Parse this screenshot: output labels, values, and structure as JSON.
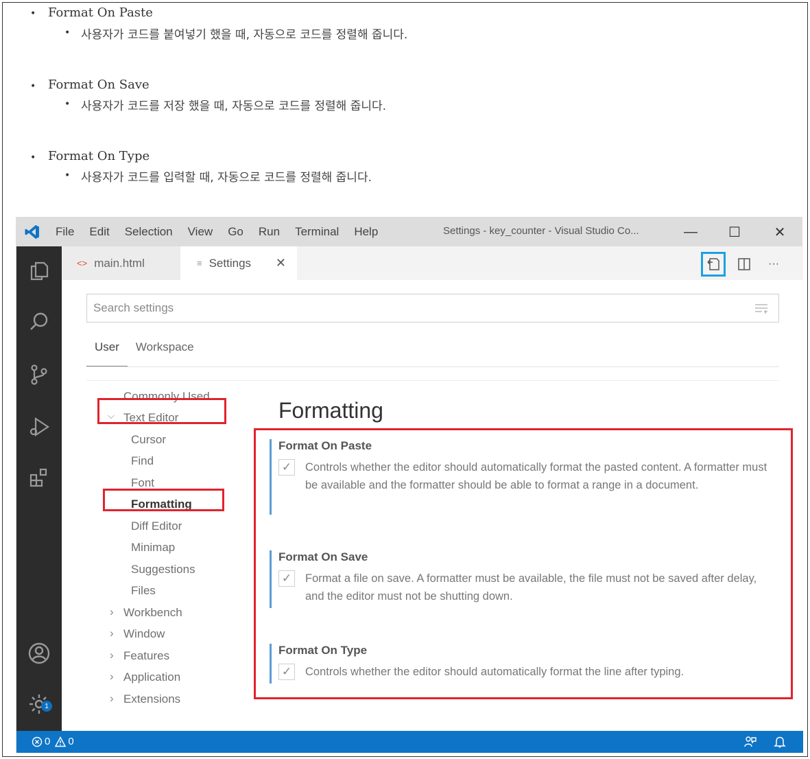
{
  "doc": {
    "items": [
      {
        "title": "Format On Paste",
        "desc": "사용자가 코드를 붙여넣기 했을 때, 자동으로 코드를 정렬해 줍니다."
      },
      {
        "title": "Format On Save",
        "desc": "사용자가 코드를 저장 했을 때, 자동으로 코드를 정렬해 줍니다."
      },
      {
        "title": "Format On Type",
        "desc": "사용자가 코드를 입력할 때, 자동으로 코드를 정렬해 줍니다."
      }
    ]
  },
  "titlebar": {
    "menu": [
      "File",
      "Edit",
      "Selection",
      "View",
      "Go",
      "Run",
      "Terminal",
      "Help"
    ],
    "window_title": "Settings - key_counter - Visual Studio Co...",
    "minimize": "—",
    "maximize": "☐",
    "close": "✕"
  },
  "tabs": [
    {
      "label": "main.html",
      "icon": "<>"
    },
    {
      "label": "Settings",
      "icon": "≡",
      "close": "✕"
    }
  ],
  "tab_actions": [
    "open-settings-json-icon",
    "split-editor-icon",
    "more-actions-icon"
  ],
  "more_label": "···",
  "search": {
    "placeholder": "Search settings"
  },
  "scope_tabs": [
    "User",
    "Workspace"
  ],
  "toc": {
    "commonly_used": "Commonly Used",
    "text_editor": "Text Editor",
    "text_editor_children": [
      "Cursor",
      "Find",
      "Font",
      "Formatting",
      "Diff Editor",
      "Minimap",
      "Suggestions",
      "Files"
    ],
    "collapsed": [
      "Workbench",
      "Window",
      "Features",
      "Application",
      "Extensions"
    ],
    "chevron_open": "⌵",
    "chevron_closed": "›"
  },
  "section_title": "Formatting",
  "settings": [
    {
      "name": "Format On Paste",
      "checked": true,
      "description": "Controls whether the editor should automatically format the pasted content. A formatter must be available and the formatter should be able to format a range in a document."
    },
    {
      "name": "Format On Save",
      "checked": true,
      "description": "Format a file on save. A formatter must be available, the file must not be saved after delay, and the editor must not be shutting down."
    },
    {
      "name": "Format On Type",
      "checked": true,
      "description": "Controls whether the editor should automatically format the line after typing."
    }
  ],
  "checkmark": "✓",
  "status": {
    "errors": "0",
    "warnings": "0"
  },
  "badge": "1",
  "colors": {
    "statusbar": "#0e74c6",
    "highlight_red": "#e0232e",
    "highlight_blue": "#1ba1e2",
    "activity_bar": "#2c2c2c"
  }
}
